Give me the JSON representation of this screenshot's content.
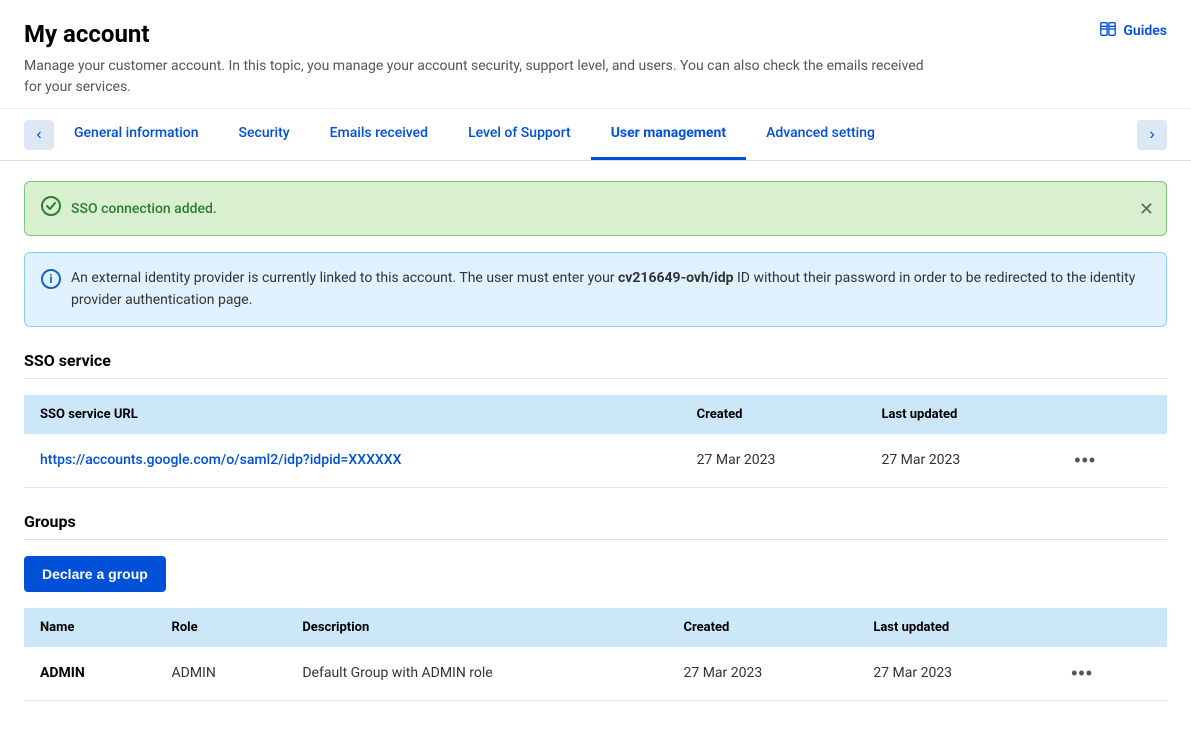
{
  "page": {
    "title": "My account",
    "description": "Manage your customer account. In this topic, you manage your account security, support level, and users. You can also check the emails received for your services.",
    "guides_label": "Guides"
  },
  "tabs": [
    {
      "id": "general",
      "label": "General information",
      "active": false
    },
    {
      "id": "security",
      "label": "Security",
      "active": false
    },
    {
      "id": "emails",
      "label": "Emails received",
      "active": false
    },
    {
      "id": "support",
      "label": "Level of Support",
      "active": false
    },
    {
      "id": "users",
      "label": "User management",
      "active": true
    },
    {
      "id": "advanced",
      "label": "Advanced setting",
      "active": false
    }
  ],
  "banners": {
    "success": {
      "text": "SSO connection added."
    },
    "info": {
      "text_before": "An external identity provider is currently linked to this account. The user must enter your ",
      "highlight": "cv216649-ovh/idp",
      "text_after": " ID without their password in order to be redirected to the identity provider authentication page."
    }
  },
  "sso_section": {
    "title": "SSO service",
    "table": {
      "headers": [
        "SSO service URL",
        "Created",
        "Last updated",
        ""
      ],
      "rows": [
        {
          "url": "https://accounts.google.com/o/saml2/idp?idpid=XXXXXX",
          "created": "27 Mar 2023",
          "last_updated": "27 Mar 2023"
        }
      ]
    }
  },
  "groups_section": {
    "title": "Groups",
    "declare_button": "Declare a group",
    "table": {
      "headers": [
        "Name",
        "Role",
        "Description",
        "Created",
        "Last updated",
        ""
      ],
      "rows": [
        {
          "name": "ADMIN",
          "role": "ADMIN",
          "description": "Default Group with ADMIN role",
          "created": "27 Mar 2023",
          "last_updated": "27 Mar 2023"
        }
      ]
    }
  }
}
